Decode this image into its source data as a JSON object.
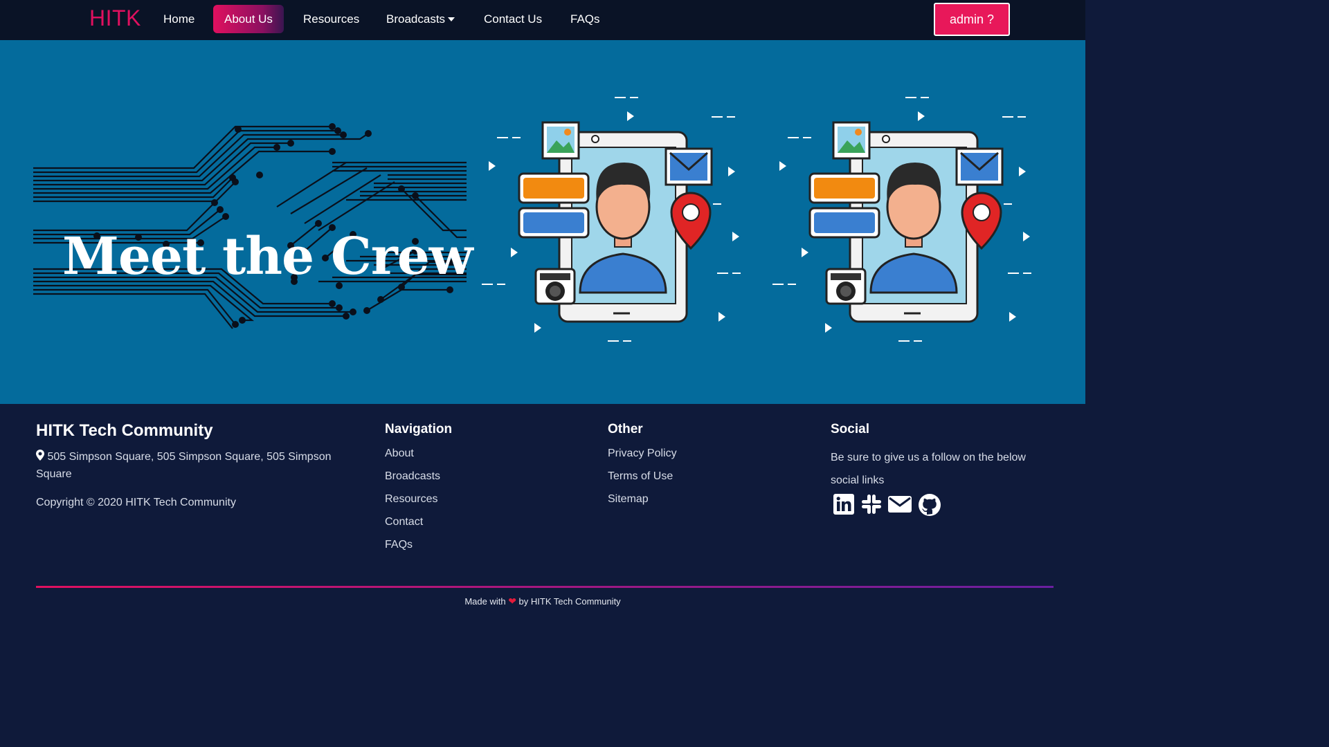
{
  "nav": {
    "brand": "HITK",
    "items": [
      {
        "label": "Home"
      },
      {
        "label": "About Us"
      },
      {
        "label": "Resources"
      },
      {
        "label": "Broadcasts"
      },
      {
        "label": "Contact Us"
      },
      {
        "label": "FAQs"
      }
    ],
    "admin_label": "admin ?"
  },
  "hero": {
    "title": "Meet the Crew"
  },
  "footer": {
    "brand": "HITK Tech Community",
    "address": "505 Simpson Square, 505 Simpson Square, 505 Simpson Square",
    "copyright": "Copyright © 2020 HITK Tech Community",
    "navigation": {
      "heading": "Navigation",
      "links": [
        "About",
        "Broadcasts",
        "Resources",
        "Contact",
        "FAQs"
      ]
    },
    "other": {
      "heading": "Other",
      "links": [
        "Privacy Policy",
        "Terms of Use",
        "Sitemap"
      ]
    },
    "social": {
      "heading": "Social",
      "text": "Be sure to give us a follow on the below social links",
      "icons": [
        "linkedin-icon",
        "slack-icon",
        "mail-icon",
        "github-icon"
      ]
    },
    "made_prefix": "Made with",
    "made_suffix": "by HITK Tech Community"
  },
  "colors": {
    "accent": "#e0105f",
    "navbar_bg": "#0a1326",
    "hero_bg": "#046b9c",
    "footer_bg": "#0f1a3a"
  }
}
